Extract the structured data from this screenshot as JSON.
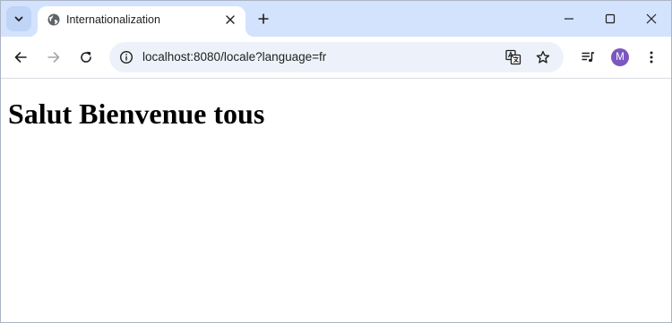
{
  "browser": {
    "tab": {
      "title": "Internationalization",
      "favicon": "globe-icon"
    },
    "address_bar": {
      "url": "localhost:8080/locale?language=fr"
    },
    "profile": {
      "initial": "M",
      "color": "#7b57c0"
    },
    "colors": {
      "tabstrip": "#d3e3fd",
      "omnibox": "#edf2fa"
    }
  },
  "page": {
    "heading": "Salut Bienvenue tous"
  }
}
